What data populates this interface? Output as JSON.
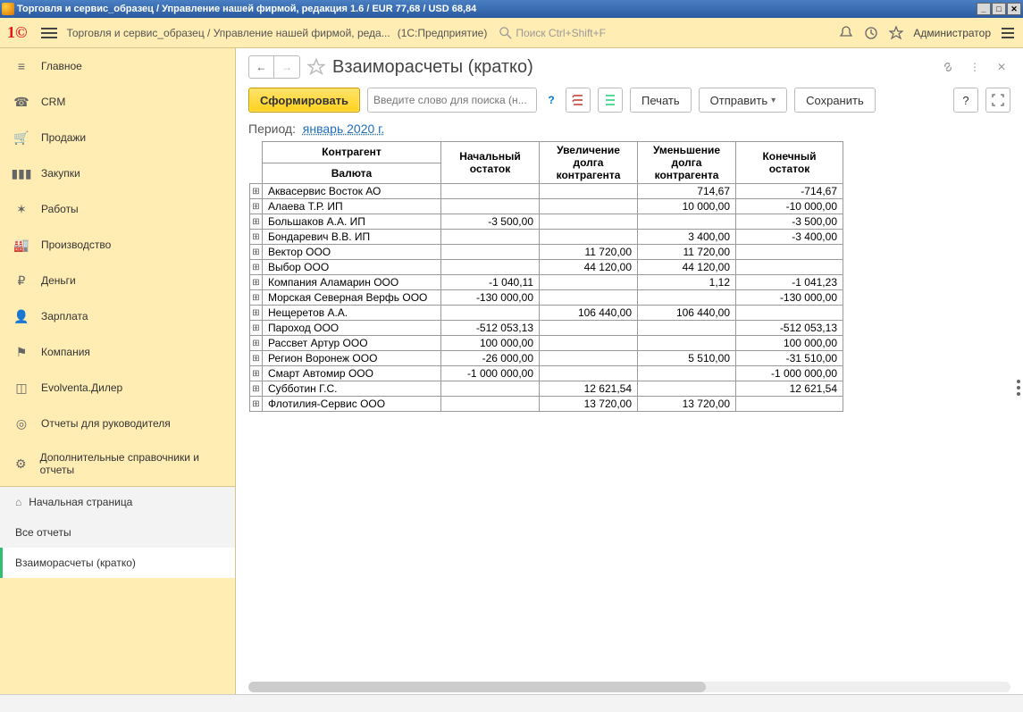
{
  "window_title": "Торговля и сервис_образец / Управление нашей фирмой, редакция 1.6 / EUR 77,68 / USD 68,84",
  "topbar": {
    "breadcrumb": "Торговля и сервис_образец / Управление нашей фирмой, реда...",
    "context": "(1С:Предприятие)",
    "search_placeholder": "Поиск Ctrl+Shift+F",
    "user": "Администратор"
  },
  "sidebar": {
    "items": [
      {
        "label": "Главное",
        "icon": "≡"
      },
      {
        "label": "CRM",
        "icon": "☎"
      },
      {
        "label": "Продажи",
        "icon": "🛒"
      },
      {
        "label": "Закупки",
        "icon": "▮▮▮"
      },
      {
        "label": "Работы",
        "icon": "✶"
      },
      {
        "label": "Производство",
        "icon": "🏭"
      },
      {
        "label": "Деньги",
        "icon": "₽"
      },
      {
        "label": "Зарплата",
        "icon": "👤"
      },
      {
        "label": "Компания",
        "icon": "⚑"
      },
      {
        "label": "Evolventa.Дилер",
        "icon": "◫"
      },
      {
        "label": "Отчеты для руководителя",
        "icon": "◎"
      },
      {
        "label": "Дополнительные справочники и отчеты",
        "icon": "⚙"
      }
    ],
    "sub": [
      {
        "label": "Начальная страница"
      },
      {
        "label": "Все отчеты"
      },
      {
        "label": "Взаиморасчеты (кратко)"
      }
    ]
  },
  "page": {
    "title": "Взаиморасчеты (кратко)",
    "generate": "Сформировать",
    "search_placeholder": "Введите слово для поиска (н...",
    "print": "Печать",
    "send": "Отправить",
    "save": "Сохранить",
    "period_label": "Период:",
    "period_value": "январь 2020 г."
  },
  "report": {
    "headers": {
      "contragent": "Контрагент",
      "currency": "Валюта",
      "start": "Начальный остаток",
      "inc": "Увеличение долга контрагента",
      "dec": "Уменьшение долга контрагента",
      "end": "Конечный остаток"
    },
    "rows": [
      {
        "name": "Аквасервис Восток АО",
        "start": "",
        "inc": "",
        "dec": "714,67",
        "end": "-714,67"
      },
      {
        "name": "Алаева Т.Р. ИП",
        "start": "",
        "inc": "",
        "dec": "10 000,00",
        "end": "-10 000,00"
      },
      {
        "name": "Большаков А.А. ИП",
        "start": "-3 500,00",
        "inc": "",
        "dec": "",
        "end": "-3 500,00"
      },
      {
        "name": "Бондаревич В.В. ИП",
        "start": "",
        "inc": "",
        "dec": "3 400,00",
        "end": "-3 400,00"
      },
      {
        "name": "Вектор ООО",
        "start": "",
        "inc": "11 720,00",
        "dec": "11 720,00",
        "end": ""
      },
      {
        "name": "Выбор ООО",
        "start": "",
        "inc": "44 120,00",
        "dec": "44 120,00",
        "end": ""
      },
      {
        "name": "Компания Аламарин ООО",
        "start": "-1 040,11",
        "inc": "",
        "dec": "1,12",
        "end": "-1 041,23"
      },
      {
        "name": "Морская Северная Верфь ООО",
        "start": "-130 000,00",
        "inc": "",
        "dec": "",
        "end": "-130 000,00"
      },
      {
        "name": "Нещеретов А.А.",
        "start": "",
        "inc": "106 440,00",
        "dec": "106 440,00",
        "end": ""
      },
      {
        "name": "Пароход ООО",
        "start": "-512 053,13",
        "inc": "",
        "dec": "",
        "end": "-512 053,13"
      },
      {
        "name": "Рассвет Артур ООО",
        "start": "100 000,00",
        "inc": "",
        "dec": "",
        "end": "100 000,00"
      },
      {
        "name": "Регион Воронеж ООО",
        "start": "-26 000,00",
        "inc": "",
        "dec": "5 510,00",
        "end": "-31 510,00"
      },
      {
        "name": "Смарт Автомир ООО",
        "start": "-1 000 000,00",
        "inc": "",
        "dec": "",
        "end": "-1 000 000,00"
      },
      {
        "name": "Субботин Г.С.",
        "start": "",
        "inc": "12 621,54",
        "dec": "",
        "end": "12 621,54"
      },
      {
        "name": "Флотилия-Сервис ООО",
        "start": "",
        "inc": "13 720,00",
        "dec": "13 720,00",
        "end": ""
      }
    ]
  }
}
